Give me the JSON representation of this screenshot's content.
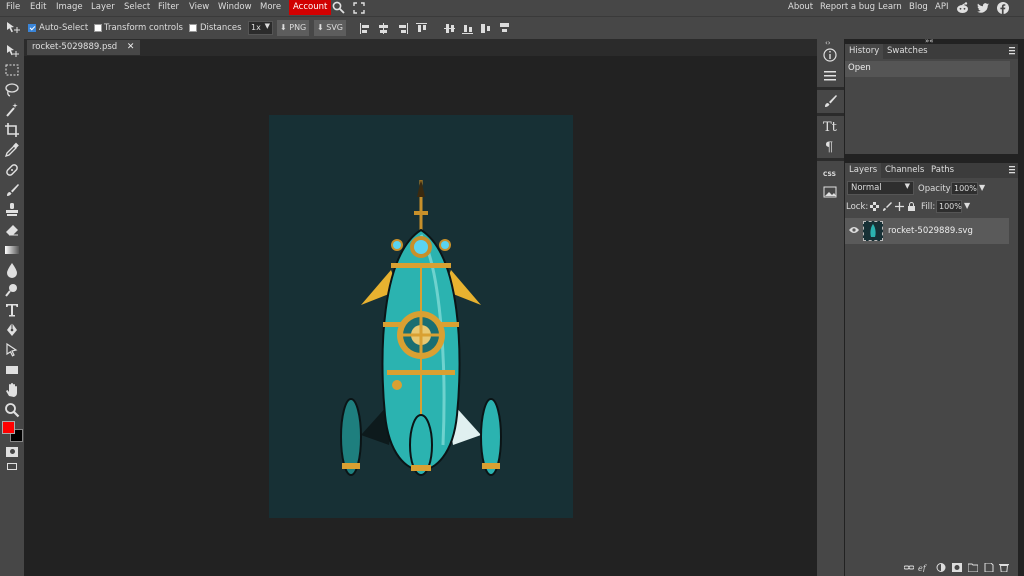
{
  "menu": {
    "items": [
      "File",
      "Edit",
      "Image",
      "Layer",
      "Select",
      "Filter",
      "View",
      "Window",
      "More",
      "Account"
    ],
    "right_links": [
      "About",
      "Report a bug",
      "Learn",
      "Blog",
      "API"
    ],
    "social_icons": [
      "reddit-icon",
      "twitter-icon",
      "facebook-icon"
    ]
  },
  "options": {
    "auto_select": {
      "label": "Auto-Select",
      "checked": true
    },
    "transform_controls": {
      "label": "Transform controls",
      "checked": false
    },
    "distances": {
      "label": "Distances",
      "checked": false
    },
    "zoom_value": "1x",
    "export_png": "PNG",
    "export_svg": "SVG"
  },
  "document": {
    "tab_name": "rocket-5029889.psd",
    "canvas_color": "#173035"
  },
  "history_panel": {
    "tabs": [
      "History",
      "Swatches"
    ],
    "active_tab": "History",
    "entries": [
      "Open"
    ]
  },
  "layers_panel": {
    "tabs": [
      "Layers",
      "Channels",
      "Paths"
    ],
    "active_tab": "Layers",
    "blend_mode": "Normal",
    "opacity_label": "Opacity:",
    "opacity_value": "100%",
    "lock_label": "Lock:",
    "fill_label": "Fill:",
    "fill_value": "100%",
    "layers": [
      {
        "name": "rocket-5029889.svg",
        "visible": true
      }
    ]
  },
  "colors": {
    "foreground": "#ff0000",
    "background": "#000000",
    "accent": "#d10000"
  }
}
